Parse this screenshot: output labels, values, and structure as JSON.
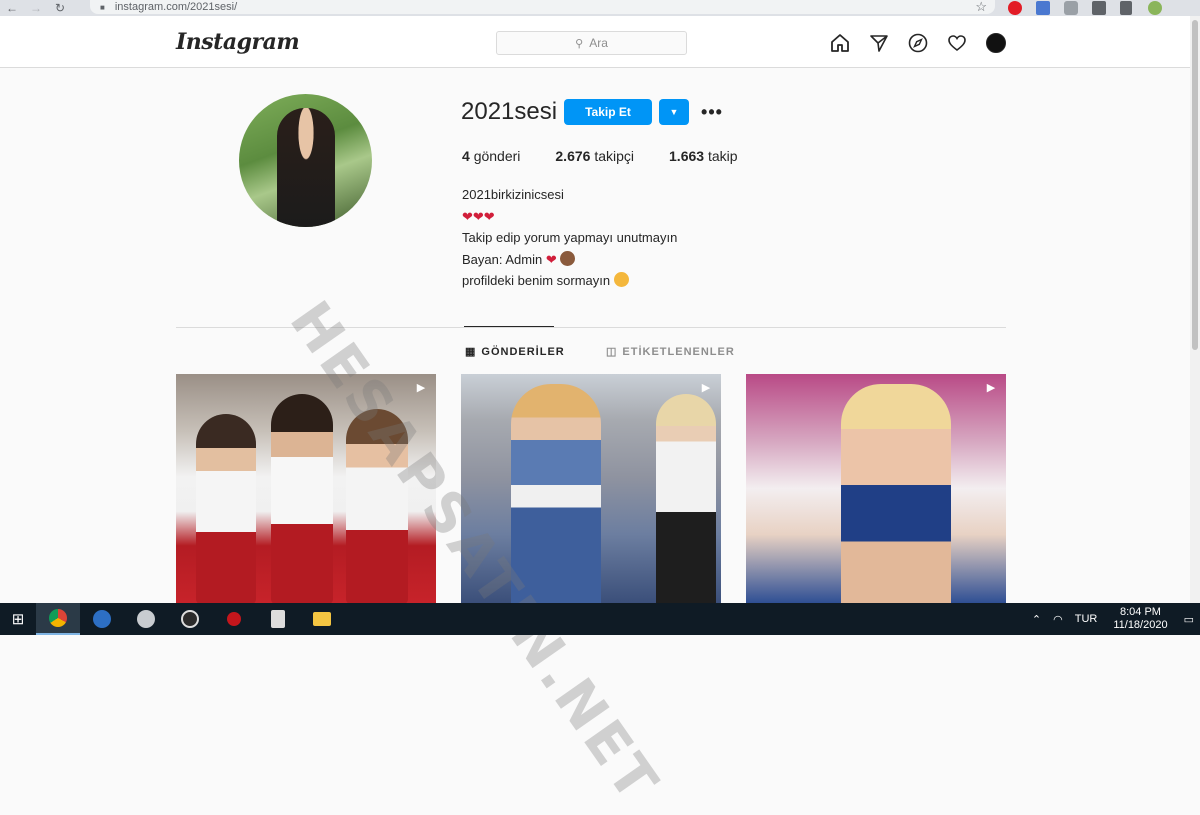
{
  "browser": {
    "url": "instagram.com/2021sesi/"
  },
  "header": {
    "logo": "Instagram",
    "search_placeholder": "Ara"
  },
  "profile": {
    "username": "2021sesi",
    "follow_label": "Takip Et",
    "posts_count": "4",
    "posts_label": "gönderi",
    "followers_count": "2.676",
    "followers_label": "takipçi",
    "following_count": "1.663",
    "following_label": "takip",
    "full_name": "2021birkizinicsesi",
    "bio_lines": [
      "Takip edip yorum yapmayı unutmayın",
      "Bayan: Admin",
      "profildeki benim sormayın"
    ]
  },
  "tabs": [
    {
      "label": "GÖNDERİLER",
      "active": true
    },
    {
      "label": "ETİKETLENENLER",
      "active": false
    }
  ],
  "watermark": "HESAPSATIN.NET",
  "taskbar": {
    "lang": "TUR",
    "time": "8:04 PM",
    "date": "11/18/2020"
  },
  "colors": {
    "accent": "#0095f6",
    "taskbar": "#0f1b25"
  }
}
